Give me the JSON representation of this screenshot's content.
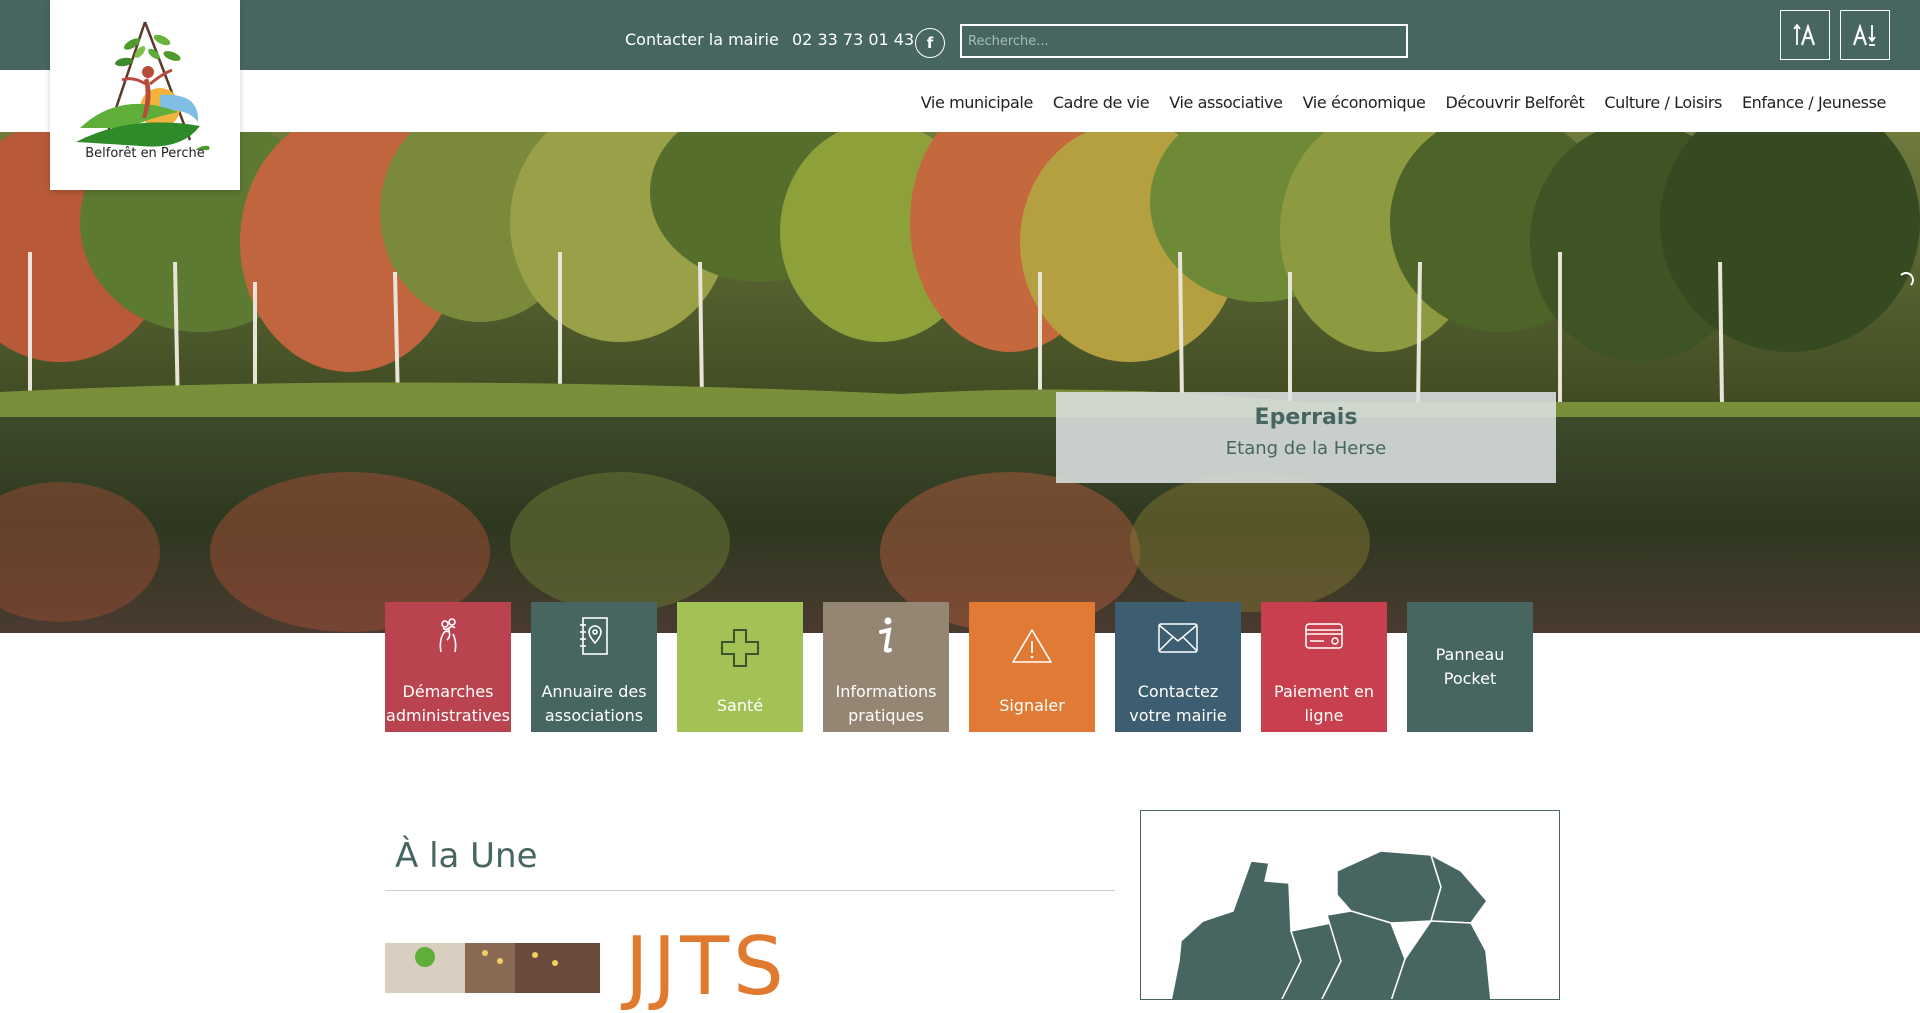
{
  "topbar": {
    "contact_label": "Contacter la mairie",
    "phone": "02 33 73 01 43",
    "facebook_glyph": "f",
    "search_placeholder": "Recherche..."
  },
  "logo": {
    "text": "Belforêt en Perche"
  },
  "nav": {
    "items": [
      {
        "label": "Vie municipale"
      },
      {
        "label": "Cadre de vie"
      },
      {
        "label": "Vie associative"
      },
      {
        "label": "Vie économique"
      },
      {
        "label": "Découvrir Belforêt"
      },
      {
        "label": "Culture / Loisirs"
      },
      {
        "label": "Enfance / Jeunesse"
      }
    ]
  },
  "hero": {
    "title": "Eperrais",
    "subtitle": "Etang de la Herse"
  },
  "tiles": [
    {
      "label": "Démarches administratives",
      "icon": "hands-icon",
      "color": "#b9434f"
    },
    {
      "label": "Annuaire des associations",
      "icon": "notebook-pin-icon",
      "color": "#476661"
    },
    {
      "label": "Santé",
      "icon": "cross-icon",
      "color": "#a3c256"
    },
    {
      "label": "Informations pratiques",
      "icon": "info-icon",
      "color": "#948673"
    },
    {
      "label": "Signaler",
      "icon": "warning-icon",
      "color": "#e07a35"
    },
    {
      "label": "Contactez votre mairie",
      "icon": "envelope-icon",
      "color": "#3d5e70"
    },
    {
      "label": "Paiement en ligne",
      "icon": "card-icon",
      "color": "#c8404f"
    },
    {
      "label": "Panneau Pocket",
      "icon": "",
      "color": "#476661"
    }
  ],
  "une": {
    "title": "À la Une",
    "partial_text": "JJTS"
  },
  "colors": {
    "primary": "#476661",
    "white": "#ffffff"
  }
}
